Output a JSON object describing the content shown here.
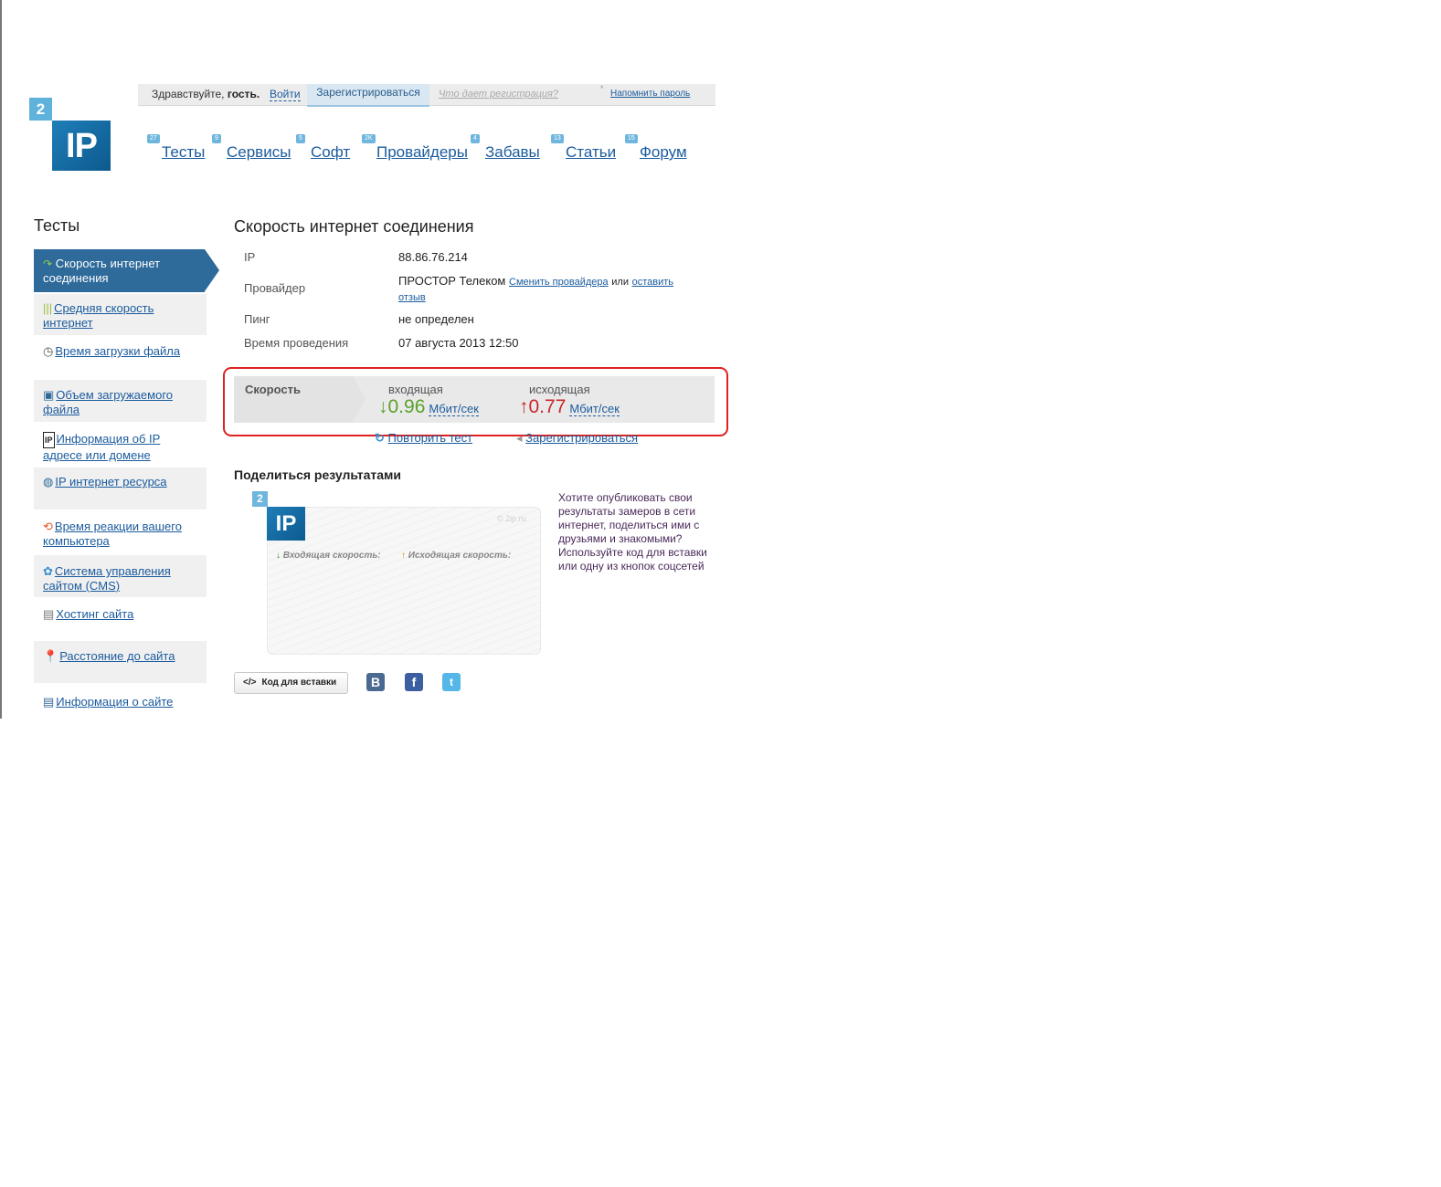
{
  "topbar": {
    "greeting": "Здравствуйте,",
    "guest": "гость.",
    "login": "Войти",
    "register": "Зарегистрироваться",
    "what_gives": "Что дает регистрация?",
    "remind": "Напомнить пароль"
  },
  "logo": {
    "badge": "2",
    "main": "IP"
  },
  "nav": [
    {
      "label": "Тесты",
      "count": "27"
    },
    {
      "label": "Сервисы",
      "count": "9"
    },
    {
      "label": "Софт",
      "count": "5"
    },
    {
      "label": "Провайдеры",
      "count": "2K"
    },
    {
      "label": "Забавы",
      "count": "4"
    },
    {
      "label": "Статьи",
      "count": "13"
    },
    {
      "label": "Форум",
      "count": "15"
    }
  ],
  "sidebar": {
    "title": "Тесты",
    "active_line1": "Скорость интернет",
    "active_line2": "соединения",
    "items": [
      {
        "line1": "Средняя скорость",
        "line2": "интернет",
        "icon": "bars-icon"
      },
      {
        "line1": "Время загрузки файла",
        "line2": "",
        "icon": "clock-icon"
      },
      {
        "line1": "Объем загружаемого",
        "line2": "файла",
        "icon": "file-size-icon"
      },
      {
        "line1": "Информация об IP",
        "line2": "адресе или домене",
        "icon": "ip-info-icon"
      },
      {
        "line1": "IP интернет ресурса",
        "line2": "",
        "icon": "ip-globe-icon"
      },
      {
        "line1": "Время реакции вашего",
        "line2": "компьютера",
        "icon": "reaction-icon"
      },
      {
        "line1": "Система управления",
        "line2": "сайтом (CMS)",
        "icon": "cms-icon"
      },
      {
        "line1": "Хостинг сайта",
        "line2": "",
        "icon": "hosting-icon"
      },
      {
        "line1": "Расстояние до сайта",
        "line2": "",
        "icon": "map-pin-icon"
      },
      {
        "line1": "Информация о сайте",
        "line2": "",
        "icon": "site-info-icon"
      }
    ]
  },
  "main": {
    "title": "Скорость интернет соединения",
    "ip_label": "IP",
    "ip_value": "88.86.76.214",
    "provider_label": "Провайдер",
    "provider_value": "ПРОСТОР Телеком",
    "change_provider": "Сменить провайдера",
    "or": "или",
    "leave": "оставить",
    "review": "отзыв",
    "ping_label": "Пинг",
    "ping_value": "не определен",
    "time_label": "Время проведения",
    "time_value": "07 августа 2013 12:50"
  },
  "speed": {
    "label": "Скорость",
    "in_label": "входящая",
    "in_value": "0.96",
    "in_unit": "Мбит/сек",
    "out_label": "исходящая",
    "out_value": "0.77",
    "out_unit": "Мбит/сек",
    "in_color": "#5aa02a",
    "out_color": "#c8282c"
  },
  "actions": {
    "retest": "Повторить тест",
    "register": "Зарегистрироваться"
  },
  "share": {
    "title": "Поделиться результатами",
    "preview_badge": "2",
    "preview_logo": "IP",
    "preview_copy": "© 2ip.ru",
    "preview_in": "Входящая скорость:",
    "preview_out": "Исходящая скорость:",
    "text": "Хотите опубликовать свои результаты замеров в сети интернет, поделиться ими с друзьями и знакомыми? Используйте код для вставки или одну из кнопок соцсетей",
    "embed": "Код для вставки",
    "embed_icon": "</>",
    "vk": "B",
    "fb": "f",
    "tw": "t"
  }
}
